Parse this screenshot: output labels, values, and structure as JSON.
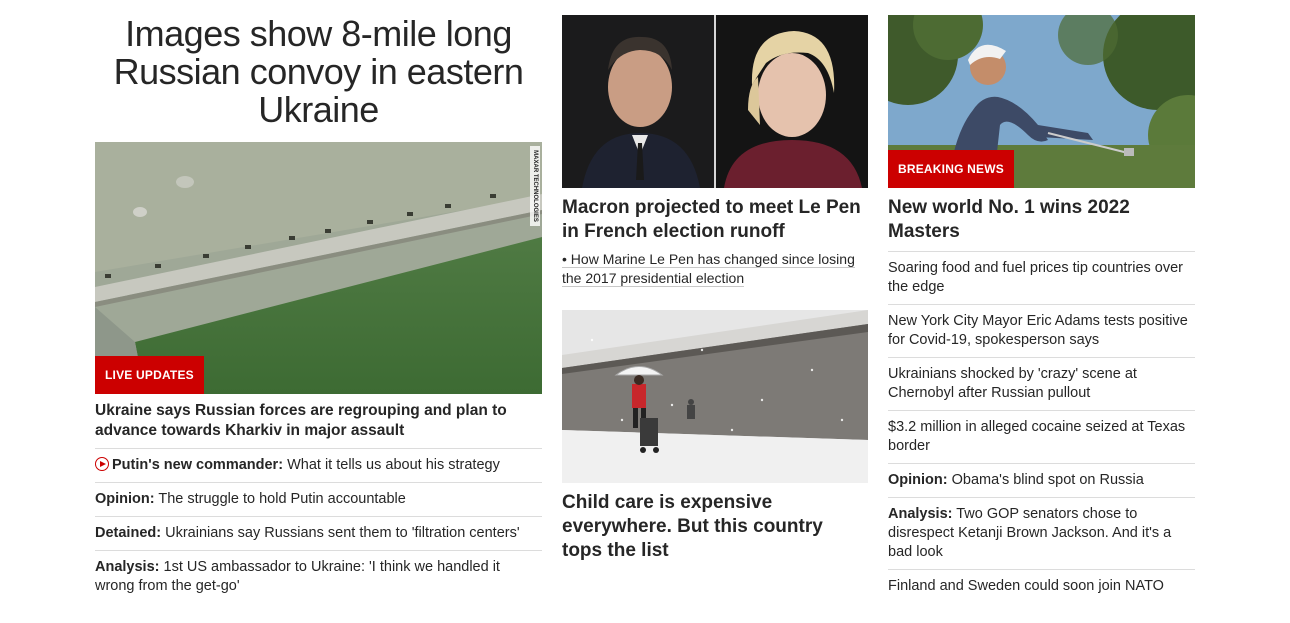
{
  "col1": {
    "headline": "Images show 8-mile long Russian convoy in eastern Ukraine",
    "image_credit": "MAXAR TECHNOLOGIES",
    "badge": "LIVE UPDATES",
    "lead_title": "Ukraine says Russian forces are regrouping and plan to advance towards Kharkiv in major assault",
    "items": [
      {
        "bold": "Putin's new commander:",
        "text": " What it tells us about his strategy",
        "icon": "play-icon"
      },
      {
        "bold": "Opinion:",
        "text": " The struggle to hold Putin accountable"
      },
      {
        "bold": "Detained:",
        "text": " Ukrainians say Russians sent them to 'filtration centers'"
      },
      {
        "bold": "Analysis:",
        "text": " 1st US ambassador to Ukraine: 'I think we handled it wrong from the get-go'"
      }
    ]
  },
  "col2": {
    "story1": {
      "title": "Macron projected to meet Le Pen in French election runoff",
      "sublink": "• How Marine Le Pen has changed since losing the 2017 presidential election"
    },
    "story2": {
      "title": "Child care is expensive everywhere. But this country tops the list"
    }
  },
  "col3": {
    "badge": "BREAKING NEWS",
    "lead_title": "New world No. 1 wins 2022 Masters",
    "items": [
      {
        "bold": "",
        "text": "Soaring food and fuel prices tip countries over the edge"
      },
      {
        "bold": "",
        "text": "New York City Mayor Eric Adams tests positive for Covid-19, spokesperson says"
      },
      {
        "bold": "",
        "text": "Ukrainians shocked by 'crazy' scene at Chernobyl after Russian pullout"
      },
      {
        "bold": "",
        "text": "$3.2 million in alleged cocaine seized at Texas border"
      },
      {
        "bold": "Opinion:",
        "text": " Obama's blind spot on Russia"
      },
      {
        "bold": "Analysis:",
        "text": " Two GOP senators chose to disrespect Ketanji Brown Jackson. And it's a bad look"
      },
      {
        "bold": "",
        "text": "Finland and Sweden could soon join NATO"
      }
    ]
  },
  "colors": {
    "accent": "#cc0000",
    "text": "#262626",
    "divider": "#dcdcdc"
  }
}
